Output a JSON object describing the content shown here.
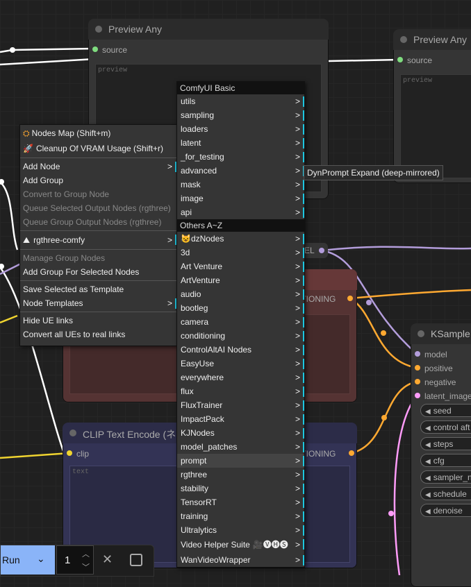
{
  "colors": {
    "model": "#b39ddb",
    "clip": "#f0d430",
    "conditioning": "#ffa931",
    "latent": "#ff9cf9",
    "image": "#64b5f6",
    "accent": "#1ec6e0",
    "run": "#8ab4f8"
  },
  "nodes": {
    "preview1": {
      "title": "Preview Any",
      "input": "source",
      "preview": "preview"
    },
    "preview2": {
      "title": "Preview Any",
      "input": "source",
      "preview": "preview"
    },
    "clip_pos_output": "ITIONING",
    "clip_neg": {
      "title": "CLIP Text Encode (ネ",
      "input": "clip",
      "output": "ITIONING",
      "text_placeholder": "text"
    },
    "ckpt_output": "EL",
    "ksampler": {
      "title": "KSample",
      "inputs": [
        "model",
        "positive",
        "negative",
        "latent_image"
      ],
      "widgets": [
        "seed",
        "control aft",
        "steps",
        "cfg",
        "sampler_n",
        "schedule",
        "denoise"
      ]
    }
  },
  "canvas_menu": {
    "items": [
      {
        "label": "Nodes Map (Shift+m)",
        "icon": "hierarchy-icon"
      },
      {
        "label": "Cleanup Of VRAM Usage (Shift+r)",
        "icon": "rocket-icon"
      },
      {
        "sep": true
      },
      {
        "label": "Add Node",
        "submenu": true
      },
      {
        "label": "Add Group"
      },
      {
        "label": "Convert to Group Node",
        "disabled": true
      },
      {
        "label": "Queue Selected Output Nodes (rgthree)",
        "disabled": true
      },
      {
        "label": "Queue Group Output Nodes (rgthree)",
        "disabled": true
      },
      {
        "sep": true
      },
      {
        "label": "rgthree-comfy",
        "submenu": true,
        "icon": "rgthree-icon"
      },
      {
        "sep": true
      },
      {
        "label": "Manage Group Nodes",
        "disabled": true
      },
      {
        "label": "Add Group For Selected Nodes"
      },
      {
        "sep": true
      },
      {
        "label": "Save Selected as Template"
      },
      {
        "label": "Node Templates",
        "submenu": true
      },
      {
        "sep": true
      },
      {
        "label": "Hide UE links"
      },
      {
        "label": "Convert all UEs to real links"
      }
    ]
  },
  "node_menu": {
    "basic_header": "ComfyUI Basic",
    "basic": [
      "utils",
      "sampling",
      "loaders",
      "latent",
      "_for_testing",
      "advanced",
      "mask",
      "image",
      "api"
    ],
    "others_header": "Others A~Z",
    "others": [
      "dzNodes",
      "3d",
      "Art Venture",
      "ArtVenture",
      "audio",
      "bootleg",
      "camera",
      "conditioning",
      "ControlAltAI Nodes",
      "EasyUse",
      "everywhere",
      "flux",
      "FluxTrainer",
      "ImpactPack",
      "KJNodes",
      "model_patches",
      "prompt",
      "rgthree",
      "stability",
      "TensorRT",
      "training",
      "Ultralytics",
      "Video Helper Suite",
      "WanVideoWrapper"
    ],
    "dznodes_emoji": "😺",
    "vhs_suffix": "🎥🅥🅗🅢",
    "highlighted": "prompt",
    "submenu_mark": ">"
  },
  "tooltip": "DynPrompt Expand (deep-mirrored)",
  "run": {
    "label": "Run",
    "count": "1"
  }
}
